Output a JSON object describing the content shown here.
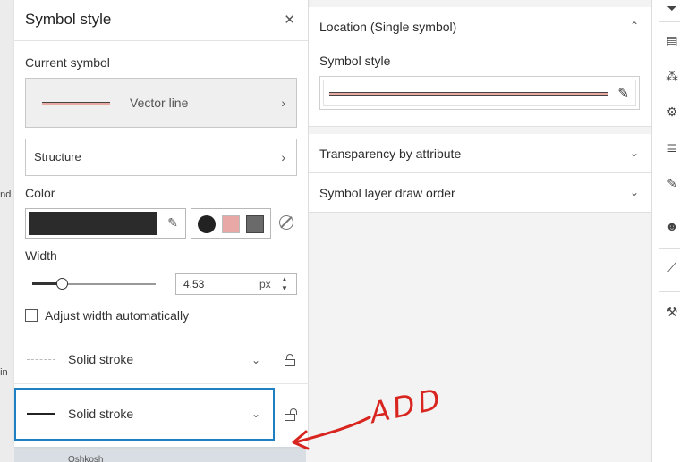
{
  "map": {
    "texts": [
      "and",
      "oin"
    ],
    "bottom_text": "Oshkosh"
  },
  "symbol_panel": {
    "title": "Symbol style",
    "close_icon": "close-icon",
    "current_symbol_label": "Current symbol",
    "current_symbol_name": "Vector line",
    "structure_label": "Structure",
    "color_label": "Color",
    "color_value": "#2b2b2b",
    "swatches": [
      "#222222",
      "#e8a8a6",
      "#6a6a6a"
    ],
    "width_label": "Width",
    "width_value": "4.53",
    "width_unit": "px",
    "width_slider_fraction": 0.2,
    "adjust_width_label": "Adjust width automatically",
    "adjust_width_checked": false,
    "layers": [
      {
        "label": "Solid stroke",
        "locked": true
      },
      {
        "label": "Solid stroke",
        "locked": false,
        "selected": true
      }
    ]
  },
  "properties": {
    "sections": [
      {
        "title": "Location (Single symbol)",
        "expanded": true
      },
      {
        "title": "Transparency by attribute",
        "expanded": false
      },
      {
        "title": "Symbol layer draw order",
        "expanded": false
      }
    ],
    "symbol_style_label": "Symbol style"
  },
  "annotation": {
    "text": "ADD",
    "color": "#d8251f"
  },
  "accent_color": "#1f7fc3"
}
